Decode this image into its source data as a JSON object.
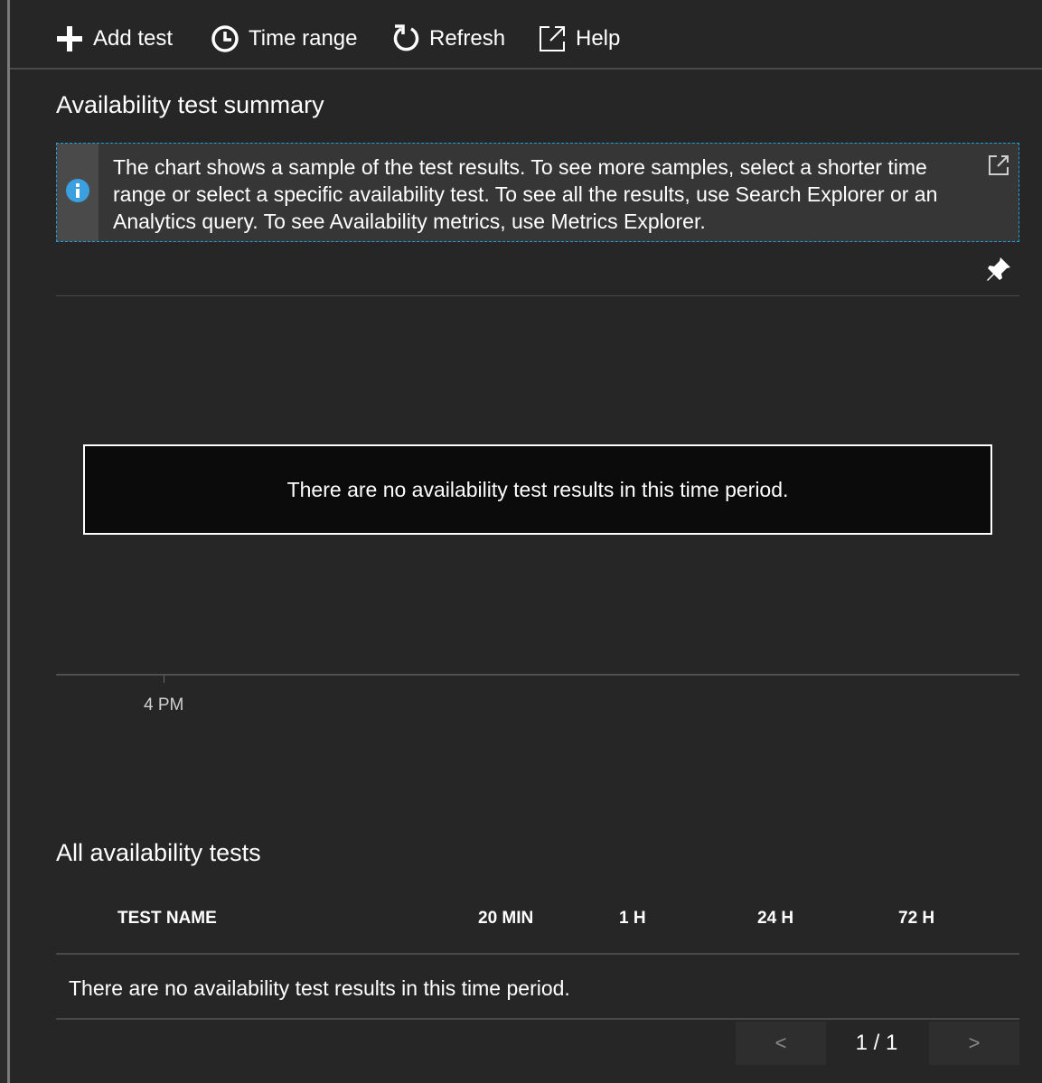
{
  "toolbar": {
    "add_test": "Add test",
    "time_range": "Time range",
    "refresh": "Refresh",
    "help": "Help"
  },
  "summary": {
    "title": "Availability test summary",
    "info_text": "The chart shows a sample of the test results. To see more samples, select a shorter time range or select a specific availability test. To see all the results, use Search Explorer or an Analytics query. To see Availability metrics, use Metrics Explorer."
  },
  "chart": {
    "empty_message": "There are no availability test results in this time period.",
    "x_tick": "4 PM"
  },
  "tests": {
    "title": "All availability tests",
    "columns": [
      "TEST NAME",
      "20 MIN",
      "1 H",
      "24 H",
      "72 H"
    ],
    "empty_message": "There are no availability test results in this time period."
  },
  "pager": {
    "prev": "<",
    "page": "1 / 1",
    "next": ">"
  },
  "colors": {
    "background": "#262626",
    "info_border": "#1ea0df",
    "info_icon": "#3aa0e0"
  }
}
